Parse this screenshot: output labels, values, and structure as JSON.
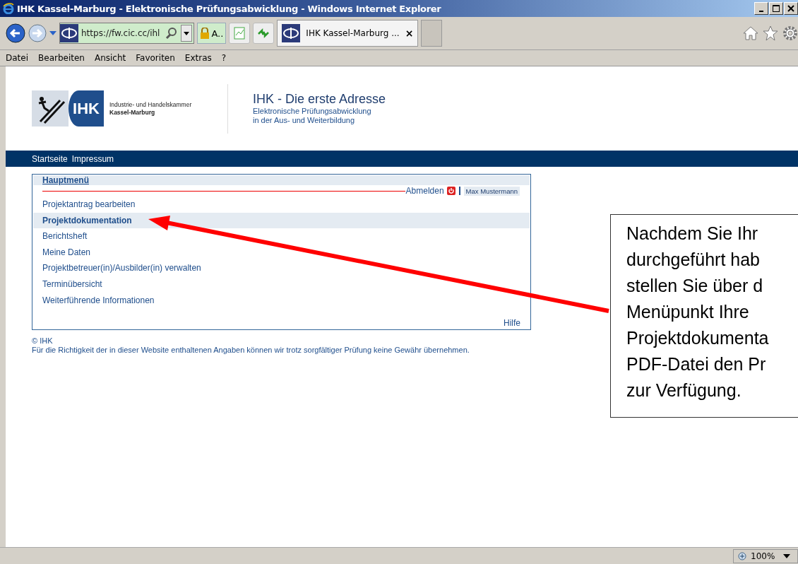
{
  "window": {
    "title": "IHK Kassel-Marburg - Elektronische Prüfungsabwicklung - Windows Internet Explorer"
  },
  "address_bar": {
    "url": "https://fw.cic.cc/ihl",
    "security_label": "A.."
  },
  "tab": {
    "title": "IHK Kassel-Marburg ...",
    "close": "×"
  },
  "menu_bar": [
    "Datei",
    "Bearbeiten",
    "Ansicht",
    "Favoriten",
    "Extras",
    "?"
  ],
  "page": {
    "logo_text": "IHK",
    "org_name": "Industrie- und Handelskammer",
    "org_region": "Kassel-Marburg",
    "heading": "IHK - Die erste Adresse",
    "subheading_lines": [
      "Elektronische Prüfungsabwicklung",
      "in der Aus- und Weiterbildung"
    ],
    "nav": [
      "Startseite",
      "Impressum"
    ],
    "main_menu": {
      "title": "Hauptmenü",
      "logout": "Abmelden",
      "user": "Max Mustermann",
      "help": "Hilfe",
      "items": [
        {
          "label": "Projektantrag bearbeiten",
          "selected": false
        },
        {
          "label": "Projektdokumentation",
          "selected": true
        },
        {
          "label": "Berichtsheft",
          "selected": false
        },
        {
          "label": "Meine Daten",
          "selected": false
        },
        {
          "label": "Projektbetreuer(in)/Ausbilder(in) verwalten",
          "selected": false
        },
        {
          "label": "Terminübersicht",
          "selected": false
        },
        {
          "label": "Weiterführende Informationen",
          "selected": false
        }
      ]
    },
    "footer": {
      "copyright": "© IHK",
      "disclaimer": "Für die Richtigkeit der in dieser Website enthaltenen Angaben können wir trotz sorgfältiger Prüfung keine Gewähr übernehmen."
    }
  },
  "callout": {
    "lines": [
      "Nachdem Sie Ihr",
      "durchgeführt hab",
      "stellen Sie über d",
      "Menüpunkt Ihre",
      "Projektdokumenta",
      "PDF-Datei den Pr",
      "zur Verfügung."
    ]
  },
  "status_bar": {
    "zoom": "100%"
  }
}
